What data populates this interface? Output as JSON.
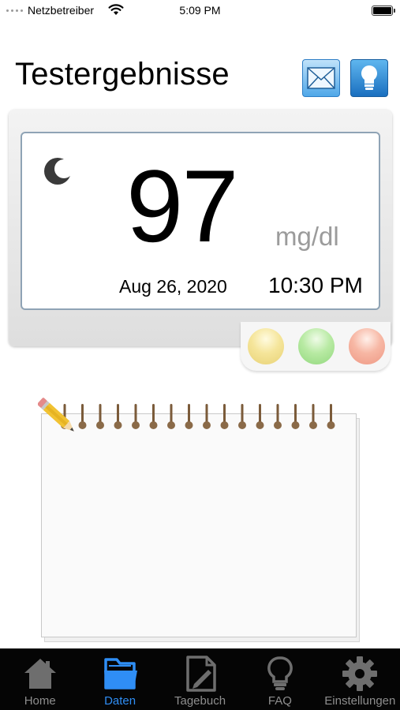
{
  "status_bar": {
    "carrier": "Netzbetreiber",
    "time": "5:09 PM"
  },
  "header": {
    "title": "Testergebnisse",
    "icons": [
      "mail-icon",
      "lightbulb-icon"
    ]
  },
  "result": {
    "value": "97",
    "unit": "mg/dl",
    "date": "Aug 26, 2020",
    "time": "10:30 PM",
    "period_icon": "moon-icon",
    "indicators": [
      {
        "name": "yellow",
        "color": "#f1df8e"
      },
      {
        "name": "green",
        "color": "#a6e393"
      },
      {
        "name": "red",
        "color": "#f4a894"
      }
    ]
  },
  "notes": {
    "text": ""
  },
  "tab_bar": {
    "active_color": "#2f8ef5",
    "inactive_color": "#8e8e8e",
    "tabs": [
      {
        "label": "Home",
        "icon": "home-icon",
        "active": false
      },
      {
        "label": "Daten",
        "icon": "folder-icon",
        "active": true
      },
      {
        "label": "Tagebuch",
        "icon": "diary-icon",
        "active": false
      },
      {
        "label": "FAQ",
        "icon": "lightbulb-icon",
        "active": false
      },
      {
        "label": "Einstellungen",
        "icon": "gear-icon",
        "active": false
      }
    ]
  }
}
